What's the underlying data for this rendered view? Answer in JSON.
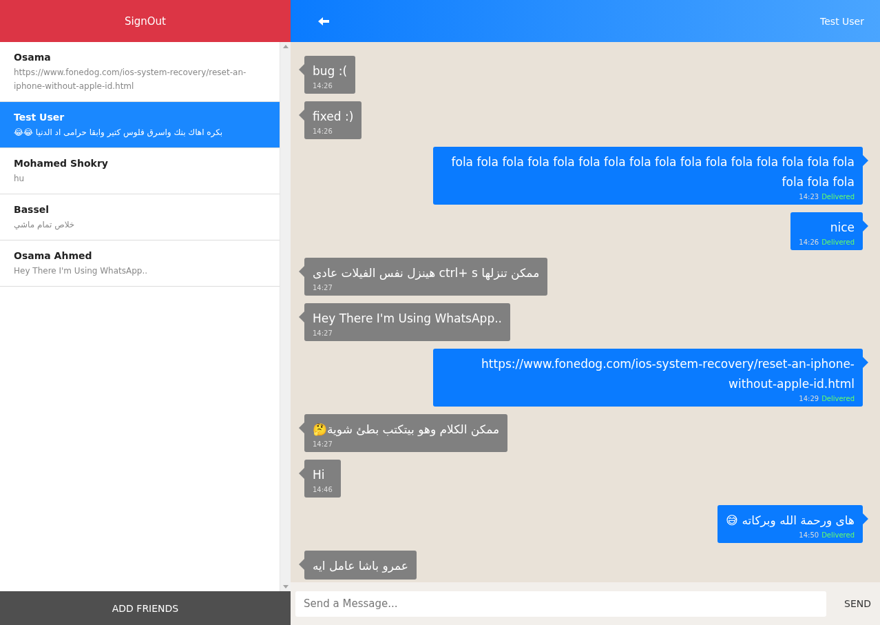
{
  "sidebar": {
    "signout": "SignOut",
    "contacts": [
      {
        "name": "Osama",
        "preview": "https://www.fonedog.com/ios-system-recovery/reset-an-iphone-without-apple-id.html",
        "selected": false
      },
      {
        "name": "Test User",
        "preview": "😂😂 بكره اهاك بنك واسرق فلوس كتير وابقا حرامى اد الدنيا",
        "selected": true
      },
      {
        "name": "Mohamed Shokry",
        "preview": "hu",
        "selected": false
      },
      {
        "name": "Bassel",
        "preview": "خلاص تمام ماشي",
        "selected": false
      },
      {
        "name": "Osama Ahmed",
        "preview": "Hey There I'm Using WhatsApp..",
        "selected": false
      }
    ],
    "add_friends": "ADD FRIENDS"
  },
  "chat": {
    "title": "Test User",
    "messages": [
      {
        "kind": "received",
        "text": "bug :(",
        "time": "14:26"
      },
      {
        "kind": "received",
        "text": "fixed :)",
        "time": "14:26"
      },
      {
        "kind": "sent",
        "text": "fola fola fola fola fola fola fola fola fola fola fola fola fola fola fola fola fola fola fola",
        "time": "14:23",
        "status": "Delivered"
      },
      {
        "kind": "sent",
        "text": "nice",
        "time": "14:26",
        "status": "Delivered"
      },
      {
        "kind": "received",
        "text": "هينزل نفس الفيلات عادى ctrl+ s ممكن تنزلها",
        "time": "14:27"
      },
      {
        "kind": "received",
        "text": "Hey There I'm Using WhatsApp..",
        "time": "14:27"
      },
      {
        "kind": "sent",
        "text": "https://www.fonedog.com/ios-system-recovery/reset-an-iphone-without-apple-id.html",
        "time": "14:29",
        "status": "Delivered"
      },
      {
        "kind": "received",
        "text": "🤔ممكن الكلام وهو بيتكتب بطئ شوية",
        "time": "14:27"
      },
      {
        "kind": "received",
        "text": "Hi",
        "time": "14:46"
      },
      {
        "kind": "sent",
        "text": "😅 هاى ورحمة الله وبركاته",
        "time": "14:50",
        "status": "Delivered"
      },
      {
        "kind": "received",
        "text": "عمرو باشا عامل ايه"
      }
    ],
    "input": {
      "placeholder": "Send a Message..."
    },
    "send": "SEND"
  }
}
